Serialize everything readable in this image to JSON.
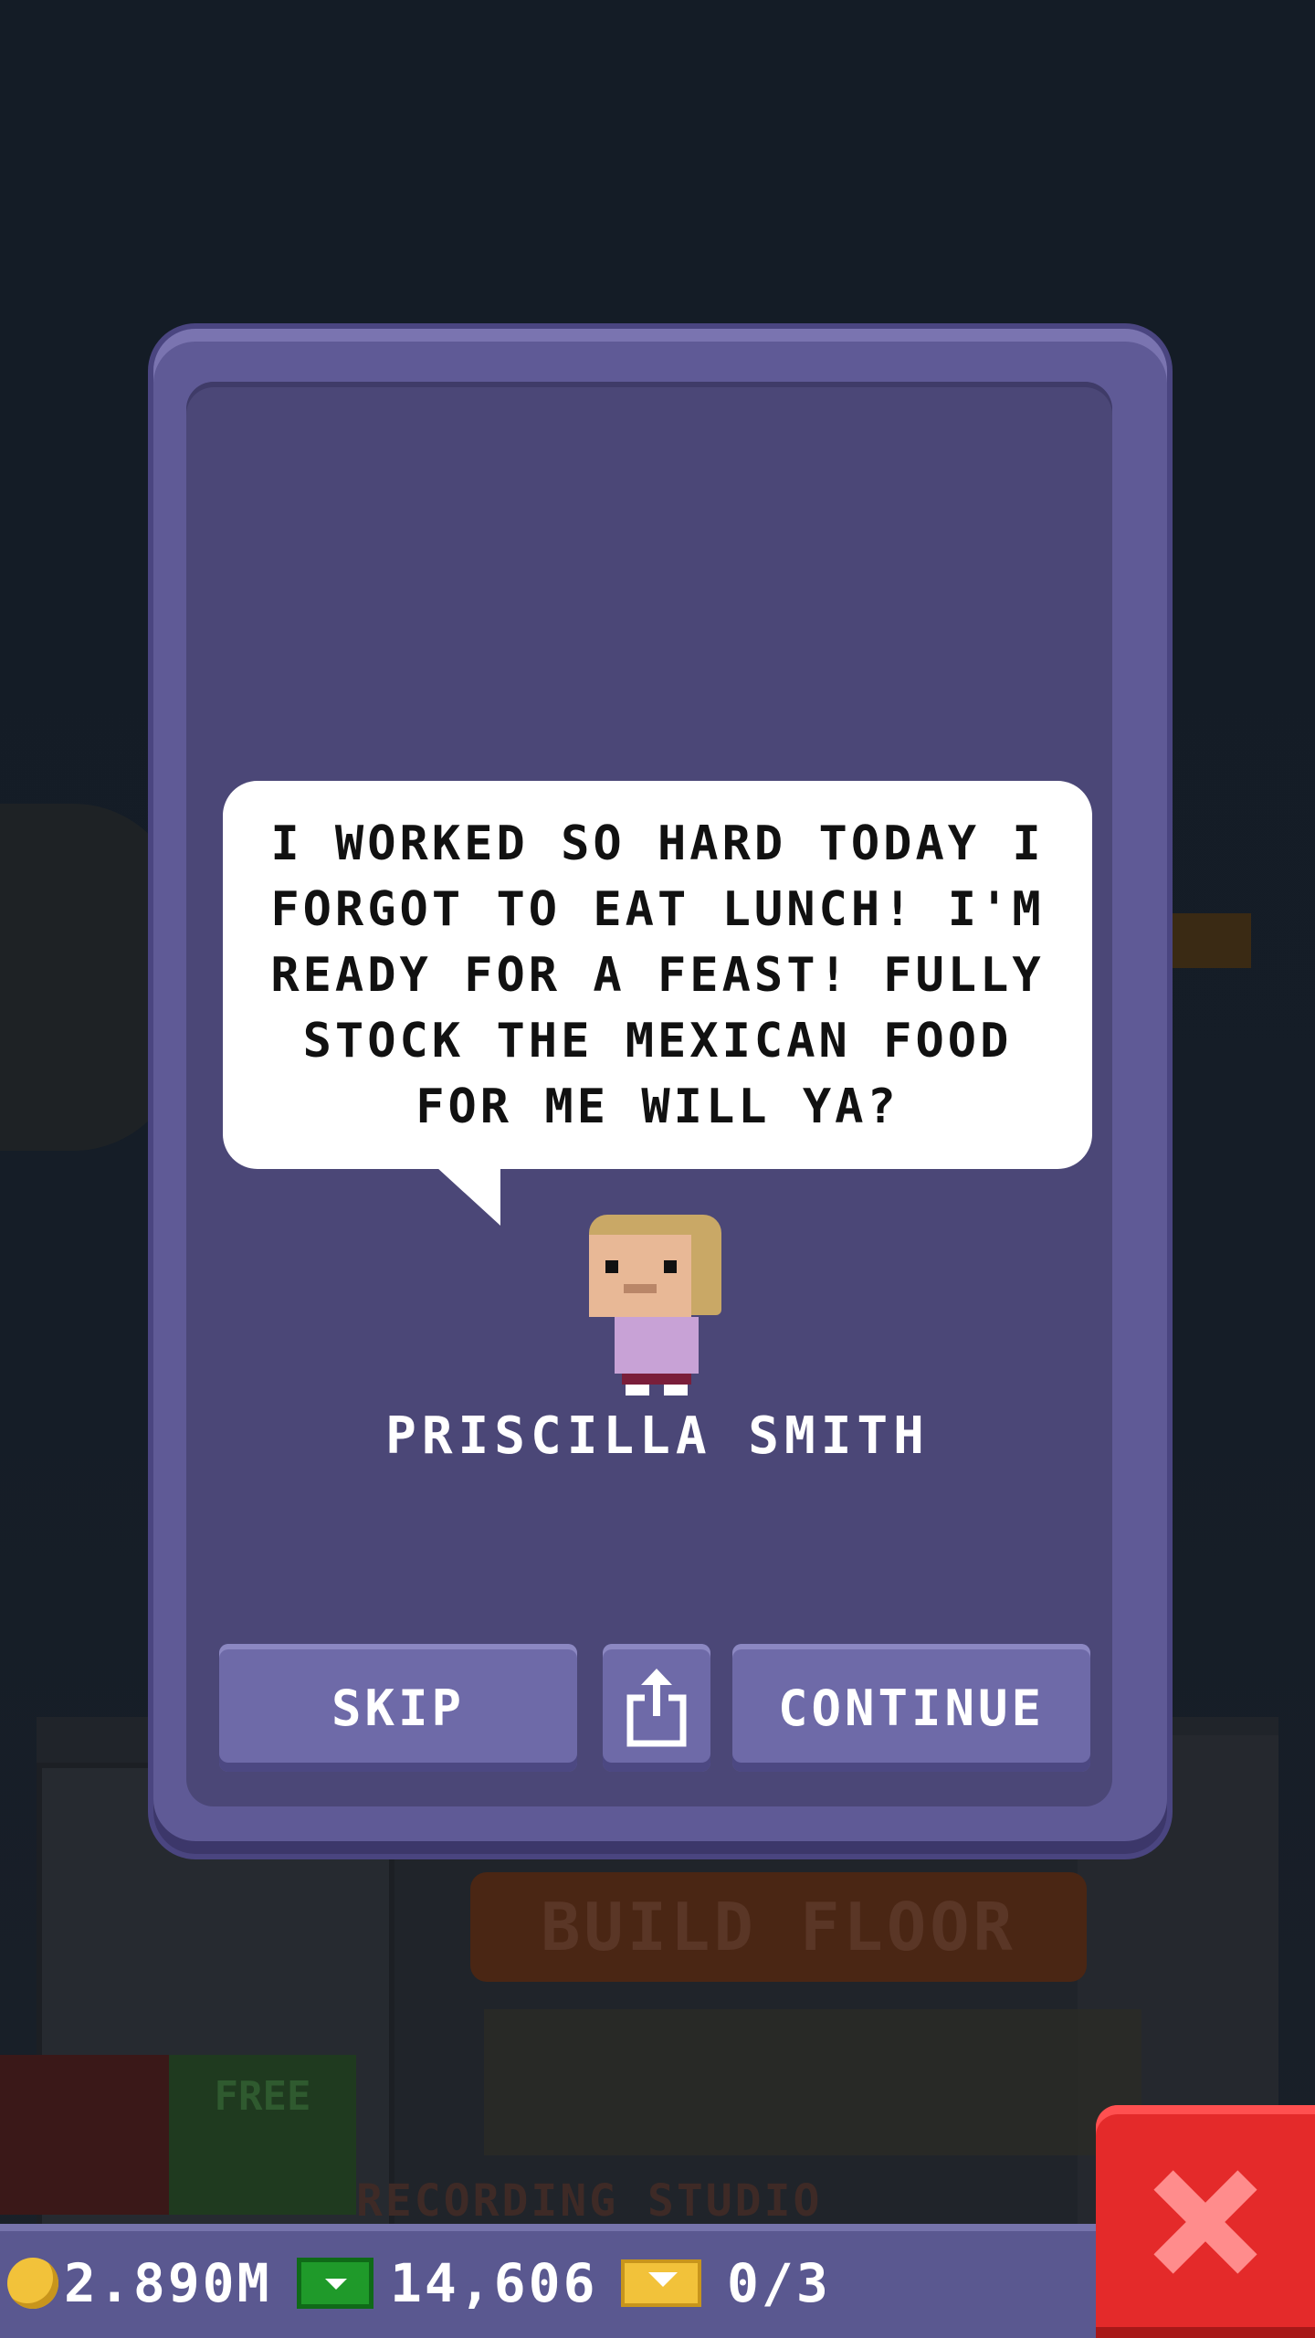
{
  "dialog": {
    "message": "I WORKED SO HARD TODAY I FORGOT TO EAT LUNCH! I'M READY FOR A FEAST! FULLY STOCK THE MEXICAN FOOD FOR ME WILL YA?",
    "character_name": "PRISCILLA SMITH",
    "buttons": {
      "skip": "SKIP",
      "share_icon": "share-icon",
      "continue": "CONTINUE"
    }
  },
  "background": {
    "build_floor_label": "BUILD FLOOR",
    "free_label": "FREE",
    "floor_name": "RECORDING STUDIO"
  },
  "status_bar": {
    "coins": "2.890M",
    "cash": "14,606",
    "tickets": "0/3",
    "coin_icon": "coin-icon",
    "cash_icon": "cash-icon",
    "ticket_icon": "ticket-icon"
  },
  "close_icon": "close-icon",
  "colors": {
    "modal": "#5f5a96",
    "modal_inner": "#4b4777",
    "button": "#6e6aa8",
    "close": "#e42a2a",
    "coin": "#f2c23a",
    "cash": "#1f9a2a"
  }
}
